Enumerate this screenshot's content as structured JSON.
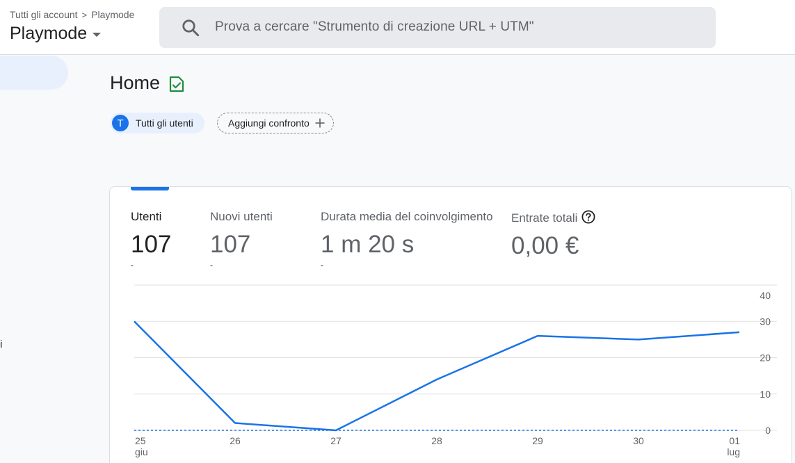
{
  "header": {
    "breadcrumb_root": "Tutti gli account",
    "breadcrumb_separator": ">",
    "breadcrumb_current": "Playmode",
    "property_name": "Playmode"
  },
  "search": {
    "placeholder": "Prova a cercare \"Strumento di creazione URL + UTM\""
  },
  "sidebar": {
    "partial_label": "i"
  },
  "page": {
    "title": "Home"
  },
  "comparison": {
    "segment_avatar": "T",
    "segment_label": "Tutti gli utenti",
    "add_label": "Aggiungi confronto"
  },
  "metrics": [
    {
      "label": "Utenti",
      "value": "107",
      "sub": "-"
    },
    {
      "label": "Nuovi utenti",
      "value": "107",
      "sub": "-"
    },
    {
      "label": "Durata media del coinvolgimento",
      "value": "1 m 20 s",
      "sub": "-"
    },
    {
      "label": "Entrate totali",
      "value": "0,00 €",
      "sub": ""
    }
  ],
  "colors": {
    "accent": "#1a73e8",
    "active_nav": "#e8f0fe",
    "success_icon": "#1e8e3e"
  },
  "icons": {
    "search": "search-icon",
    "title_badge": "verified-report-icon",
    "help": "help-circle-icon",
    "add": "plus-icon",
    "dropdown": "caret-down-icon"
  },
  "chart_data": {
    "type": "line",
    "x": [
      "25",
      "26",
      "27",
      "28",
      "29",
      "30",
      "01"
    ],
    "x_sublabels": [
      "giu",
      "",
      "",
      "",
      "",
      "",
      "lug"
    ],
    "series": [
      {
        "values": [
          30,
          2,
          0,
          14,
          26,
          25,
          27
        ],
        "style": "solid"
      },
      {
        "values": [
          0,
          0,
          0,
          0,
          0,
          0,
          0
        ],
        "style": "dashed"
      }
    ],
    "y_ticks": [
      "40",
      "30",
      "20",
      "10",
      "0"
    ],
    "ylim": [
      0,
      40
    ],
    "y_axis_position": "right",
    "grid": true
  }
}
